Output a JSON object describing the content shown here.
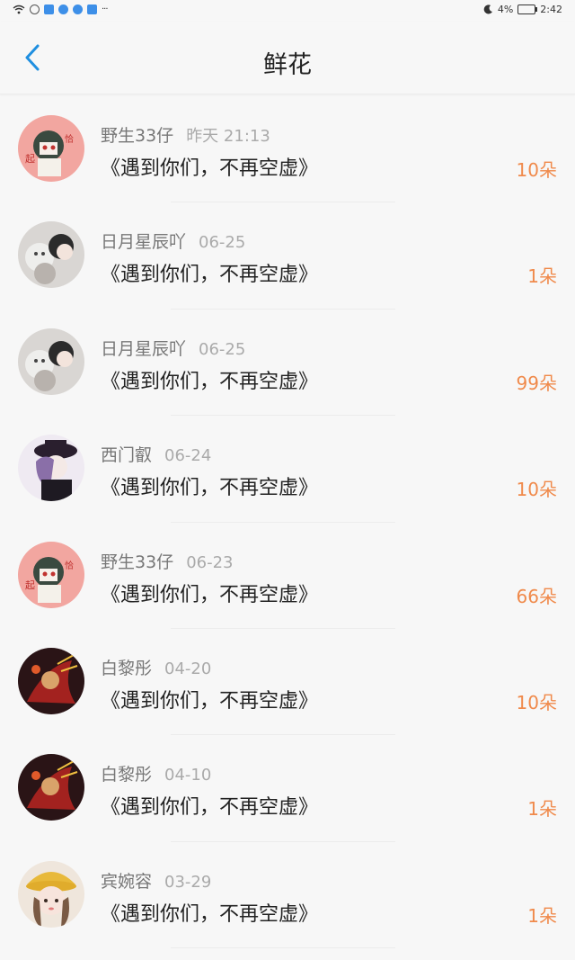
{
  "status_bar": {
    "battery": "4%",
    "time": "2:42"
  },
  "header": {
    "title": "鲜花"
  },
  "items": [
    {
      "user": "野生33仔",
      "time": "昨天 21:13",
      "content": "《遇到你们，不再空虚》",
      "count": "10朵",
      "avatar": "avatar-pink-cartoon"
    },
    {
      "user": "日月星辰吖",
      "time": "06-25",
      "content": "《遇到你们，不再空虚》",
      "count": "1朵",
      "avatar": "avatar-cats"
    },
    {
      "user": "日月星辰吖",
      "time": "06-25",
      "content": "《遇到你们，不再空虚》",
      "count": "99朵",
      "avatar": "avatar-cats"
    },
    {
      "user": "西门叡",
      "time": "06-24",
      "content": "《遇到你们，不再空虚》",
      "count": "10朵",
      "avatar": "avatar-anime-hat"
    },
    {
      "user": "野生33仔",
      "time": "06-23",
      "content": "《遇到你们，不再空虚》",
      "count": "66朵",
      "avatar": "avatar-pink-cartoon"
    },
    {
      "user": "白黎彤",
      "time": "04-20",
      "content": "《遇到你们，不再空虚》",
      "count": "10朵",
      "avatar": "avatar-red-warrior"
    },
    {
      "user": "白黎彤",
      "time": "04-10",
      "content": "《遇到你们，不再空虚》",
      "count": "1朵",
      "avatar": "avatar-red-warrior"
    },
    {
      "user": "宾婉容",
      "time": "03-29",
      "content": "《遇到你们，不再空虚》",
      "count": "1朵",
      "avatar": "avatar-girl-yellow-hat"
    }
  ],
  "colors": {
    "accent": "#1f8fe0",
    "count": "#f08a4b"
  }
}
